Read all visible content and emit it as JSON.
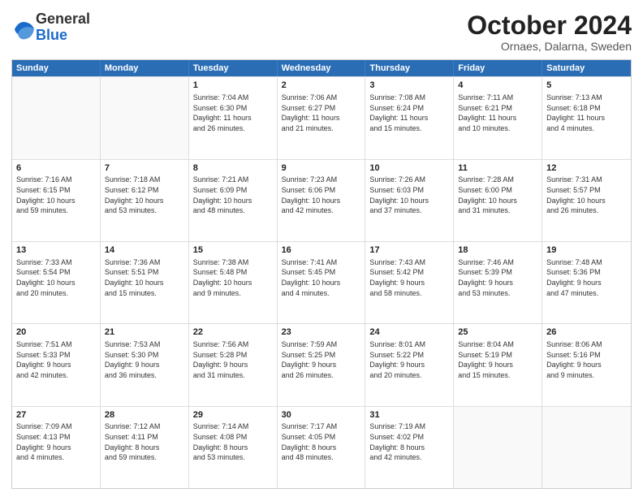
{
  "logo": {
    "text_general": "General",
    "text_blue": "Blue"
  },
  "title": "October 2024",
  "subtitle": "Ornaes, Dalarna, Sweden",
  "header_days": [
    "Sunday",
    "Monday",
    "Tuesday",
    "Wednesday",
    "Thursday",
    "Friday",
    "Saturday"
  ],
  "weeks": [
    [
      {
        "day": "",
        "empty": true
      },
      {
        "day": "",
        "empty": true
      },
      {
        "day": "1",
        "line1": "Sunrise: 7:04 AM",
        "line2": "Sunset: 6:30 PM",
        "line3": "Daylight: 11 hours",
        "line4": "and 26 minutes."
      },
      {
        "day": "2",
        "line1": "Sunrise: 7:06 AM",
        "line2": "Sunset: 6:27 PM",
        "line3": "Daylight: 11 hours",
        "line4": "and 21 minutes."
      },
      {
        "day": "3",
        "line1": "Sunrise: 7:08 AM",
        "line2": "Sunset: 6:24 PM",
        "line3": "Daylight: 11 hours",
        "line4": "and 15 minutes."
      },
      {
        "day": "4",
        "line1": "Sunrise: 7:11 AM",
        "line2": "Sunset: 6:21 PM",
        "line3": "Daylight: 11 hours",
        "line4": "and 10 minutes."
      },
      {
        "day": "5",
        "line1": "Sunrise: 7:13 AM",
        "line2": "Sunset: 6:18 PM",
        "line3": "Daylight: 11 hours",
        "line4": "and 4 minutes."
      }
    ],
    [
      {
        "day": "6",
        "line1": "Sunrise: 7:16 AM",
        "line2": "Sunset: 6:15 PM",
        "line3": "Daylight: 10 hours",
        "line4": "and 59 minutes."
      },
      {
        "day": "7",
        "line1": "Sunrise: 7:18 AM",
        "line2": "Sunset: 6:12 PM",
        "line3": "Daylight: 10 hours",
        "line4": "and 53 minutes."
      },
      {
        "day": "8",
        "line1": "Sunrise: 7:21 AM",
        "line2": "Sunset: 6:09 PM",
        "line3": "Daylight: 10 hours",
        "line4": "and 48 minutes."
      },
      {
        "day": "9",
        "line1": "Sunrise: 7:23 AM",
        "line2": "Sunset: 6:06 PM",
        "line3": "Daylight: 10 hours",
        "line4": "and 42 minutes."
      },
      {
        "day": "10",
        "line1": "Sunrise: 7:26 AM",
        "line2": "Sunset: 6:03 PM",
        "line3": "Daylight: 10 hours",
        "line4": "and 37 minutes."
      },
      {
        "day": "11",
        "line1": "Sunrise: 7:28 AM",
        "line2": "Sunset: 6:00 PM",
        "line3": "Daylight: 10 hours",
        "line4": "and 31 minutes."
      },
      {
        "day": "12",
        "line1": "Sunrise: 7:31 AM",
        "line2": "Sunset: 5:57 PM",
        "line3": "Daylight: 10 hours",
        "line4": "and 26 minutes."
      }
    ],
    [
      {
        "day": "13",
        "line1": "Sunrise: 7:33 AM",
        "line2": "Sunset: 5:54 PM",
        "line3": "Daylight: 10 hours",
        "line4": "and 20 minutes."
      },
      {
        "day": "14",
        "line1": "Sunrise: 7:36 AM",
        "line2": "Sunset: 5:51 PM",
        "line3": "Daylight: 10 hours",
        "line4": "and 15 minutes."
      },
      {
        "day": "15",
        "line1": "Sunrise: 7:38 AM",
        "line2": "Sunset: 5:48 PM",
        "line3": "Daylight: 10 hours",
        "line4": "and 9 minutes."
      },
      {
        "day": "16",
        "line1": "Sunrise: 7:41 AM",
        "line2": "Sunset: 5:45 PM",
        "line3": "Daylight: 10 hours",
        "line4": "and 4 minutes."
      },
      {
        "day": "17",
        "line1": "Sunrise: 7:43 AM",
        "line2": "Sunset: 5:42 PM",
        "line3": "Daylight: 9 hours",
        "line4": "and 58 minutes."
      },
      {
        "day": "18",
        "line1": "Sunrise: 7:46 AM",
        "line2": "Sunset: 5:39 PM",
        "line3": "Daylight: 9 hours",
        "line4": "and 53 minutes."
      },
      {
        "day": "19",
        "line1": "Sunrise: 7:48 AM",
        "line2": "Sunset: 5:36 PM",
        "line3": "Daylight: 9 hours",
        "line4": "and 47 minutes."
      }
    ],
    [
      {
        "day": "20",
        "line1": "Sunrise: 7:51 AM",
        "line2": "Sunset: 5:33 PM",
        "line3": "Daylight: 9 hours",
        "line4": "and 42 minutes."
      },
      {
        "day": "21",
        "line1": "Sunrise: 7:53 AM",
        "line2": "Sunset: 5:30 PM",
        "line3": "Daylight: 9 hours",
        "line4": "and 36 minutes."
      },
      {
        "day": "22",
        "line1": "Sunrise: 7:56 AM",
        "line2": "Sunset: 5:28 PM",
        "line3": "Daylight: 9 hours",
        "line4": "and 31 minutes."
      },
      {
        "day": "23",
        "line1": "Sunrise: 7:59 AM",
        "line2": "Sunset: 5:25 PM",
        "line3": "Daylight: 9 hours",
        "line4": "and 26 minutes."
      },
      {
        "day": "24",
        "line1": "Sunrise: 8:01 AM",
        "line2": "Sunset: 5:22 PM",
        "line3": "Daylight: 9 hours",
        "line4": "and 20 minutes."
      },
      {
        "day": "25",
        "line1": "Sunrise: 8:04 AM",
        "line2": "Sunset: 5:19 PM",
        "line3": "Daylight: 9 hours",
        "line4": "and 15 minutes."
      },
      {
        "day": "26",
        "line1": "Sunrise: 8:06 AM",
        "line2": "Sunset: 5:16 PM",
        "line3": "Daylight: 9 hours",
        "line4": "and 9 minutes."
      }
    ],
    [
      {
        "day": "27",
        "line1": "Sunrise: 7:09 AM",
        "line2": "Sunset: 4:13 PM",
        "line3": "Daylight: 9 hours",
        "line4": "and 4 minutes."
      },
      {
        "day": "28",
        "line1": "Sunrise: 7:12 AM",
        "line2": "Sunset: 4:11 PM",
        "line3": "Daylight: 8 hours",
        "line4": "and 59 minutes."
      },
      {
        "day": "29",
        "line1": "Sunrise: 7:14 AM",
        "line2": "Sunset: 4:08 PM",
        "line3": "Daylight: 8 hours",
        "line4": "and 53 minutes."
      },
      {
        "day": "30",
        "line1": "Sunrise: 7:17 AM",
        "line2": "Sunset: 4:05 PM",
        "line3": "Daylight: 8 hours",
        "line4": "and 48 minutes."
      },
      {
        "day": "31",
        "line1": "Sunrise: 7:19 AM",
        "line2": "Sunset: 4:02 PM",
        "line3": "Daylight: 8 hours",
        "line4": "and 42 minutes."
      },
      {
        "day": "",
        "empty": true
      },
      {
        "day": "",
        "empty": true
      }
    ]
  ]
}
